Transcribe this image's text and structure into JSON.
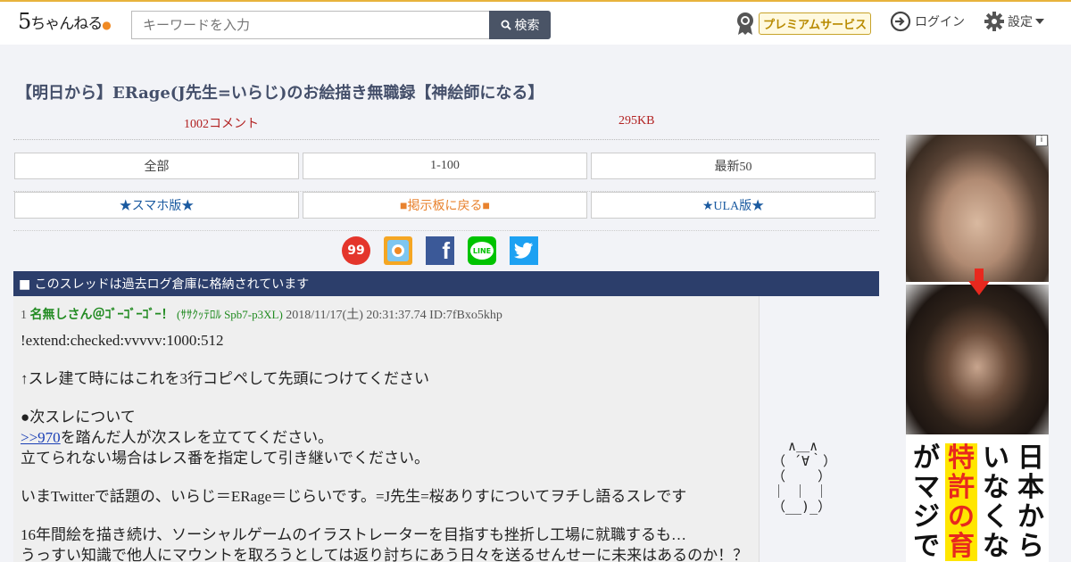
{
  "header": {
    "logo_main": "5",
    "logo_text": "ちゃんねる",
    "search_placeholder": "キーワードを入力",
    "search_button": "検索",
    "premium_label": "プレミアムサービス",
    "login_label": "ログイン",
    "settings_label": "設定"
  },
  "thread": {
    "title": "【明日から】ERage(J先生=いらじ)のお絵描き無職録【神絵師になる】",
    "comments": "1002コメント",
    "size": "295KB"
  },
  "nav": {
    "row1": [
      "全部",
      "1-100",
      "最新50"
    ],
    "row2": [
      "★スマホ版★",
      "■掲示板に戻る■",
      "★ULA版★"
    ]
  },
  "share": {
    "icons": [
      "99-icon",
      "bookmark-icon",
      "facebook-icon",
      "line-icon",
      "twitter-icon"
    ],
    "labels": {
      "s99": "99",
      "line": "LINE",
      "facebook": "f"
    }
  },
  "archive_notice": "■ このスレッドは過去ログ倉庫に格納されています",
  "post": {
    "number": "1",
    "name": "名無しさん＠ｺﾞｰｺﾞｰｺﾞｰ！",
    "trip": "(ｻｻｸｯﾃﾛﾙ Spb7-p3XL)",
    "date": "2018/11/17(土) 20:31:37.74",
    "id": "ID:7fBxo5khp",
    "lines": {
      "l1": "!extend:checked:vvvvv:1000:512",
      "l2": "↑スレ建て時にはこれを3行コピペして先頭につけてください",
      "l3": "●次スレについて",
      "l4_link": ">>970",
      "l4_rest": "を踏んだ人が次スレを立ててください。",
      "l5": "立てられない場合はレス番を指定して引き継いでください。",
      "l6": "いまTwitterで話題の、いらじ＝ERage＝じらいです。=J先生=桜ありすについてヲチし語るスレです",
      "l7": "16年間絵を描き続け、ソーシャルゲームのイラストレーターを目指すも挫折し工場に就職するも…",
      "l8": "うっすい知識で他人にマウントを取ろうとしては返り討ちにあう日々を送るせんせーに未来はあるのか！？"
    },
    "ascii_art": "  ∧＿∧\n（ ´∀｀）\n（    ）\n｜ ｜ ｜\n（__)_）"
  },
  "ad": {
    "badge": "i",
    "columns": [
      "日本から",
      "いなくな",
      "特許の育",
      "がマジで"
    ]
  },
  "colors": {
    "header_accent": "#e8b33c",
    "archive_bar": "#2c3e6b",
    "meta_red": "#b22222",
    "name_green": "#228b22",
    "link_blue": "#1a5aa0",
    "orange": "#e8822e"
  }
}
